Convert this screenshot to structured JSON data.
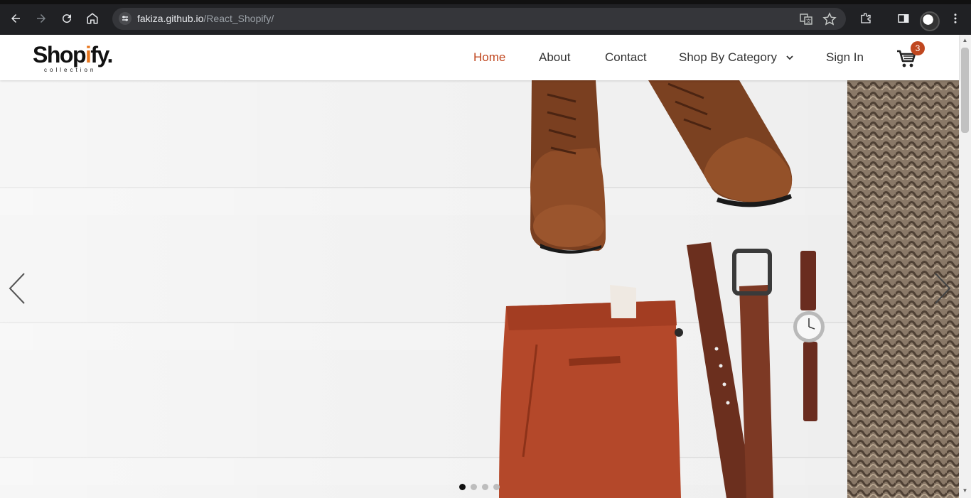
{
  "browser": {
    "url_host": "fakiza.github.io",
    "url_path": "/React_Shopify/",
    "icons": [
      "back-icon",
      "forward-icon",
      "reload-icon",
      "home-icon",
      "site-info-icon",
      "translate-icon",
      "bookmark-star-icon",
      "extensions-icon",
      "side-panel-icon",
      "profile-avatar",
      "menu-kebab-icon"
    ]
  },
  "header": {
    "logo_main_a": "Shop",
    "logo_main_b": "i",
    "logo_main_c": "fy.",
    "logo_sub": "collection",
    "nav": {
      "home": "Home",
      "about": "About",
      "contact": "Contact",
      "category": "Shop By Category",
      "signin": "Sign In"
    },
    "cart_count": "3"
  },
  "colors": {
    "accent": "#c0471f",
    "logo_accent": "#e8771f",
    "chrome_bg": "#202124"
  },
  "carousel": {
    "slide_count": 4,
    "active_index": 0
  }
}
